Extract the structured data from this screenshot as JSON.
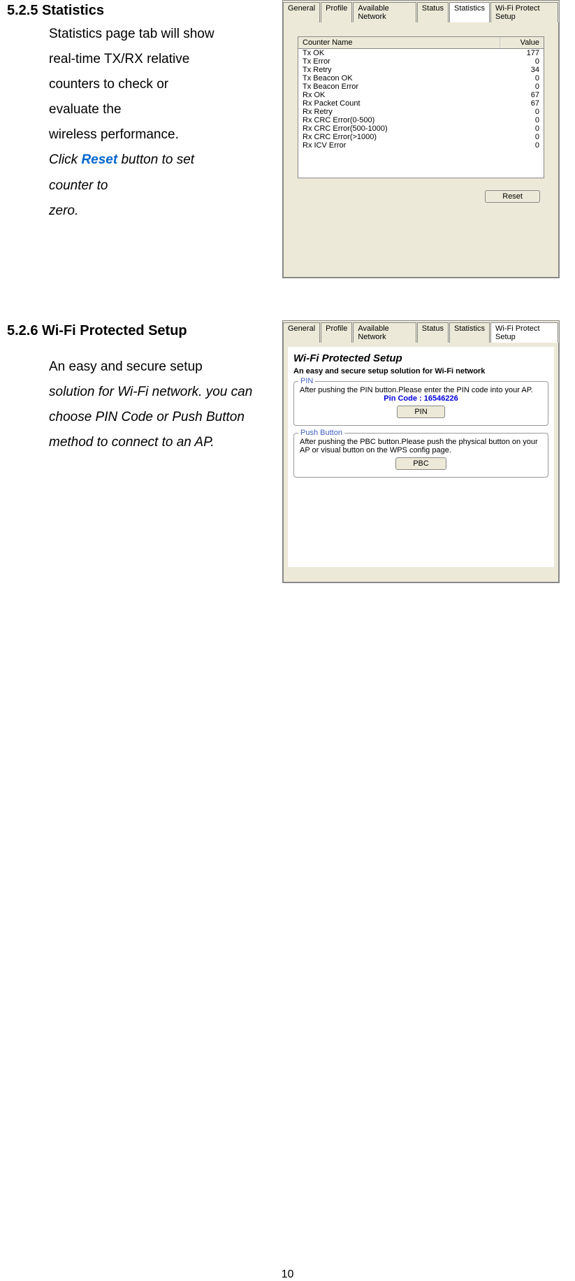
{
  "section1": {
    "heading": "5.2.5 Statistics",
    "line1": "Statistics page tab will show",
    "line2": "real-time TX/RX relative",
    "line3": "counters to check or",
    "line4": "evaluate the",
    "line5": "wireless performance.",
    "line6a": "Click ",
    "line6b": "Reset",
    "line6c": " button to set",
    "line7": "counter to",
    "line8": "zero."
  },
  "stats_screenshot": {
    "tabs": [
      "General",
      "Profile",
      "Available Network",
      "Status",
      "Statistics",
      "Wi-Fi Protect Setup"
    ],
    "active_tab": 4,
    "header_col1": "Counter Name",
    "header_col2": "Value",
    "rows": [
      {
        "name": "Tx OK",
        "value": "177"
      },
      {
        "name": "Tx Error",
        "value": "0"
      },
      {
        "name": "Tx Retry",
        "value": "34"
      },
      {
        "name": "Tx Beacon OK",
        "value": "0"
      },
      {
        "name": "Tx Beacon Error",
        "value": "0"
      },
      {
        "name": "Rx OK",
        "value": "67"
      },
      {
        "name": "Rx Packet Count",
        "value": "67"
      },
      {
        "name": "Rx Retry",
        "value": "0"
      },
      {
        "name": "Rx CRC Error(0-500)",
        "value": "0"
      },
      {
        "name": "Rx CRC Error(500-1000)",
        "value": "0"
      },
      {
        "name": "Rx CRC Error(>1000)",
        "value": "0"
      },
      {
        "name": "Rx ICV Error",
        "value": "0"
      }
    ],
    "reset_button": "Reset"
  },
  "section2": {
    "heading": "5.2.6 Wi-Fi Protected Setup",
    "line1": "An easy and secure setup",
    "line2": "solution for Wi-Fi network. you can choose PIN Code or Push Button method to connect to an AP."
  },
  "wps_screenshot": {
    "tabs": [
      "General",
      "Profile",
      "Available Network",
      "Status",
      "Statistics",
      "Wi-Fi Protect Setup"
    ],
    "active_tab": 5,
    "title": "Wi-Fi Protected Setup",
    "subtitle": "An easy and secure setup solution for Wi-Fi network",
    "pin_legend": "PIN",
    "pin_text": "After pushing the PIN button.Please enter the PIN code into your AP.",
    "pin_code_label": "Pin Code :  16546226",
    "pin_button": "PIN",
    "pb_legend": "Push Button",
    "pb_text": "After pushing the PBC button.Please push the physical button on your AP or visual button on the WPS config page.",
    "pbc_button": "PBC"
  },
  "page_number": "10"
}
